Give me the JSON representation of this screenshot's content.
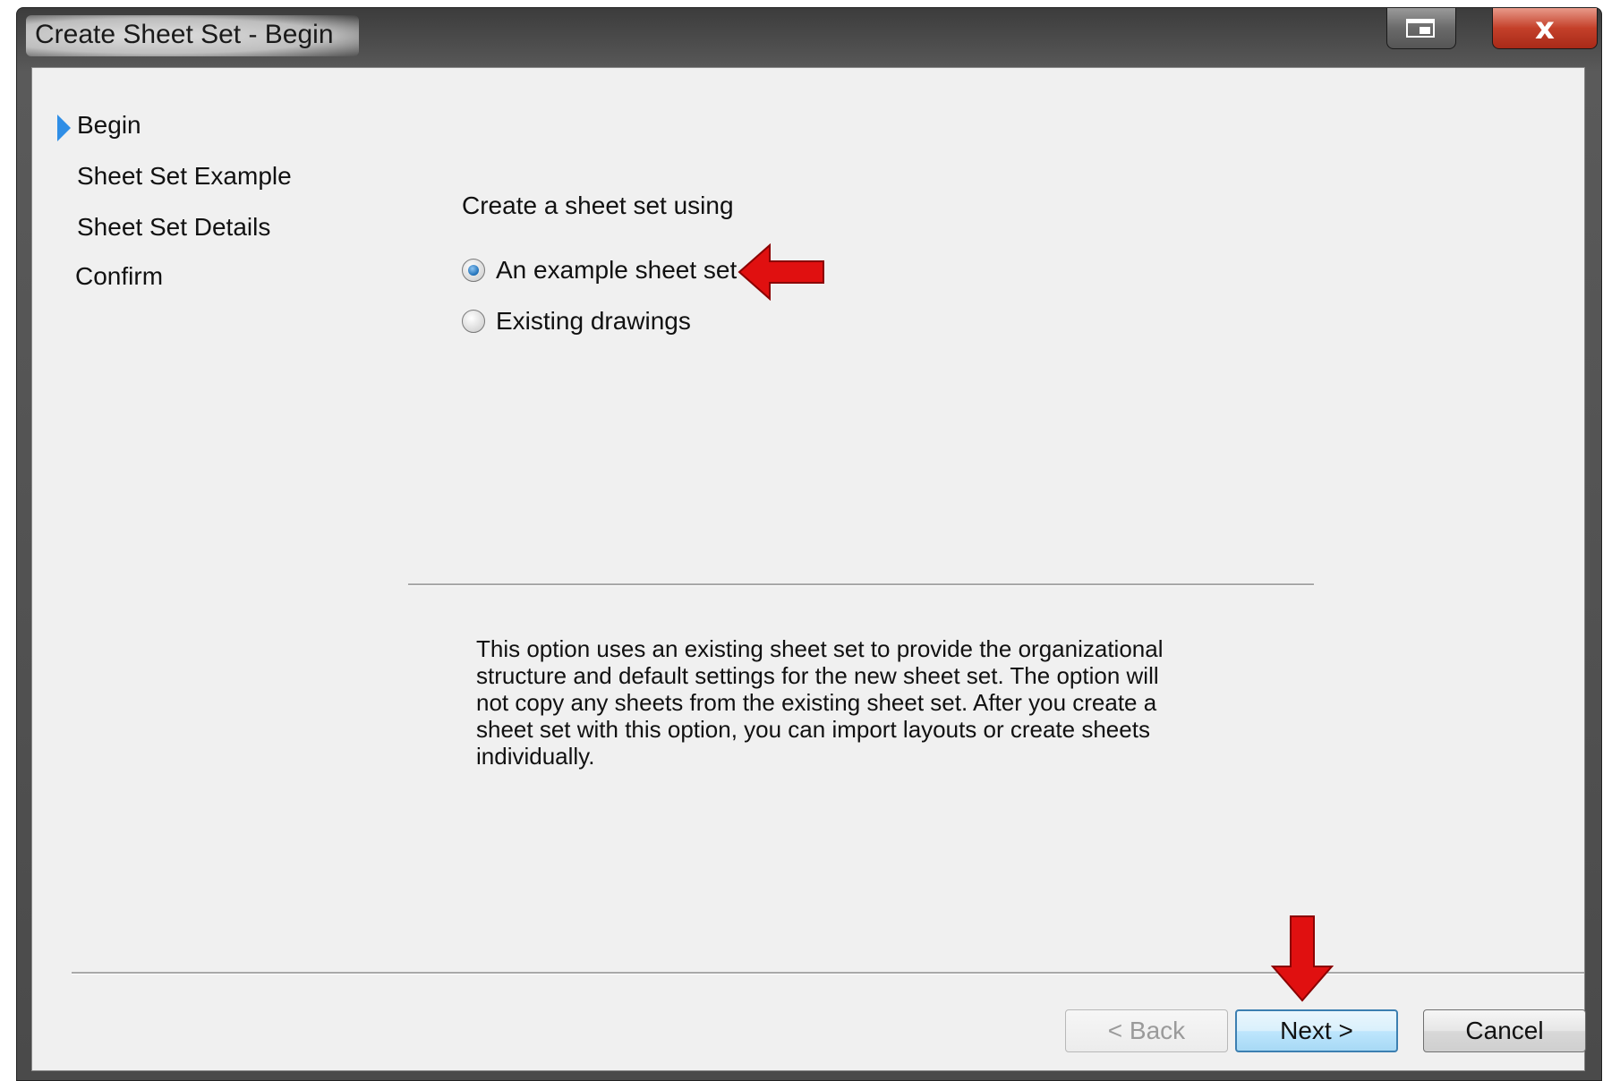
{
  "window": {
    "title": "Create Sheet Set - Begin",
    "close_symbol": "x"
  },
  "steps": [
    {
      "label": "Begin",
      "active": true
    },
    {
      "label": "Sheet Set Example",
      "active": false
    },
    {
      "label": "Sheet Set Details",
      "active": false
    },
    {
      "label": "Confirm",
      "active": false
    }
  ],
  "main": {
    "prompt": "Create a sheet set using",
    "options": [
      {
        "label": "An example sheet set",
        "checked": true
      },
      {
        "label": "Existing drawings",
        "checked": false
      }
    ],
    "description": "This option uses an existing sheet set to provide the organizational structure and default settings for the new sheet set.  The option will not copy any sheets from the existing sheet set.  After you create a sheet set with this option, you can import layouts or create sheets individually."
  },
  "buttons": {
    "back": "< Back",
    "next": "Next >",
    "cancel": "Cancel"
  },
  "colors": {
    "accent": "#2f8ee6",
    "annotation_arrow": "#e01010"
  }
}
